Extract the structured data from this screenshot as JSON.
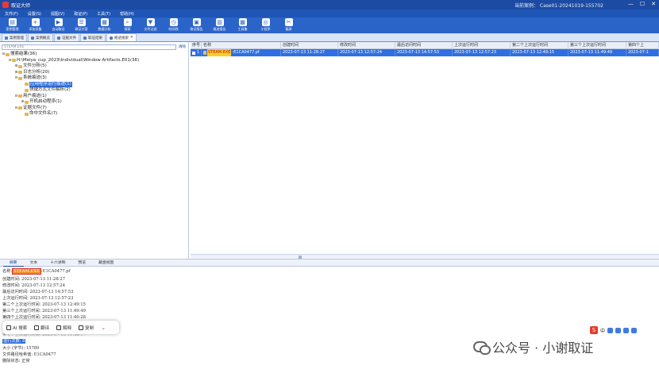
{
  "app": {
    "title": "取证大师",
    "case": "当前案例：  Case01-20241019-155702",
    "win_min": "—",
    "win_max": "☐",
    "win_close": "✕"
  },
  "menu": [
    "文件(F)",
    "设置(S)",
    "视图(V)",
    "取证(P)",
    "工具(T)",
    "帮助(H)"
  ],
  "toolbar": [
    {
      "label": "案例管理",
      "icon": "case-icon"
    },
    {
      "label": "添加设备",
      "icon": "add-device-icon"
    },
    {
      "label": "自动取证",
      "icon": "auto-icon"
    },
    {
      "label": "取证方案",
      "icon": "scheme-icon"
    },
    {
      "label": "数据分析",
      "icon": "analysis-icon"
    },
    {
      "label": "搜索",
      "icon": "search-icon"
    },
    {
      "label": "文件过滤",
      "icon": "filter-icon"
    },
    {
      "label": "时间线",
      "icon": "timeline-icon"
    },
    {
      "label": "取证报告",
      "icon": "report-icon"
    },
    {
      "label": "痕迹报告",
      "icon": "trace-report-icon"
    },
    {
      "label": "工具集",
      "icon": "tools-icon"
    },
    {
      "label": "小程序",
      "icon": "miniapp-icon"
    },
    {
      "label": "截屏",
      "icon": "screenshot-icon"
    }
  ],
  "tabs": [
    "案例管理",
    "案例概览",
    "证据文件",
    "取证结果",
    "痕迹搜索"
  ],
  "search": {
    "value": "STEAM.EXE",
    "clear": "清除"
  },
  "tree": [
    {
      "indent": 0,
      "tog": "⊟",
      "label": "搜索结果(36)"
    },
    {
      "indent": 1,
      "tog": "⊟",
      "label": "H:\\Meiya_cup_2023\\Individual\\Window Artifacts.E01(36)"
    },
    {
      "indent": 2,
      "tog": "⊞",
      "label": "文件分析(5)"
    },
    {
      "indent": 2,
      "tog": "⊞",
      "label": "日志分析(20)"
    },
    {
      "indent": 2,
      "tog": "⊟",
      "label": "系统痕迹(3)"
    },
    {
      "indent": 3,
      "tog": "",
      "label": "应用程序运行痕迹(1)",
      "selected": true
    },
    {
      "indent": 3,
      "tog": "",
      "label": "快捷方式文件解析(2)"
    },
    {
      "indent": 2,
      "tog": "⊟",
      "label": "用户痕迹(1)"
    },
    {
      "indent": 3,
      "tog": "⊞",
      "label": "开机启动程序(1)"
    },
    {
      "indent": 2,
      "tog": "⊟",
      "label": "证据文件(7)"
    },
    {
      "indent": 3,
      "tog": "",
      "label": "命中文件名(7)"
    }
  ],
  "grid": {
    "headers": [
      "序号",
      "名称",
      "创建时间",
      "修改时间",
      "最后访问时间",
      "上次运行时间",
      "第二个上次运行时间",
      "第三个上次运行时间",
      "第四个上"
    ],
    "row": {
      "index": "1",
      "name_hit": "STEAM.EXE",
      "name_rest": "-E1CA0477.pf",
      "cells": [
        "2023-07-13 11:28:27",
        "2023-07-13 12:57:24",
        "2023-07-13 14:57:53",
        "2023-07-13 12:57:23",
        "2023-07-13 12:49:15",
        "2023-07-13 11:49:49",
        "2023-07-1"
      ]
    }
  },
  "bottom_tabs": [
    "摘要",
    "文本",
    "十六进制",
    "预览",
    "藏盘视图"
  ],
  "detail": {
    "name_prefix": "名称:",
    "name_hit": "STEAM.EXE",
    "name_rest": "-E1CA0477.pf",
    "lines": [
      "创建时间: 2023-07-13 11:28:27",
      "修改时间: 2023-07-13 12:57:24",
      "最后访问时间: 2023-07-13 14:57:53",
      "上次运行时间: 2023-07-13 12:57:23",
      "第二个上次运行时间: 2023-07-13 12:49:15",
      "第三个上次运行时间: 2023-07-13 11:49:49",
      "第四个上次运行时间: 2023-07-13 11:40:28"
    ],
    "line_partial": "第七个上次运行时间: 2023-07-13 11:38:17",
    "run_count": "运行次数: 8",
    "size": "大小 (字节): 15789",
    "hash": "文件路径哈希值: E1CA0477",
    "deleted": "删除状态: 正常"
  },
  "float_bar": [
    {
      "label": "AI 搜索",
      "icon": "ai-search-icon"
    },
    {
      "label": "翻译",
      "icon": "translate-icon"
    },
    {
      "label": "解释",
      "icon": "explain-icon"
    },
    {
      "label": "复制",
      "icon": "copy-icon"
    }
  ],
  "watermark": "公众号 · 小谢取证",
  "ime": "中"
}
